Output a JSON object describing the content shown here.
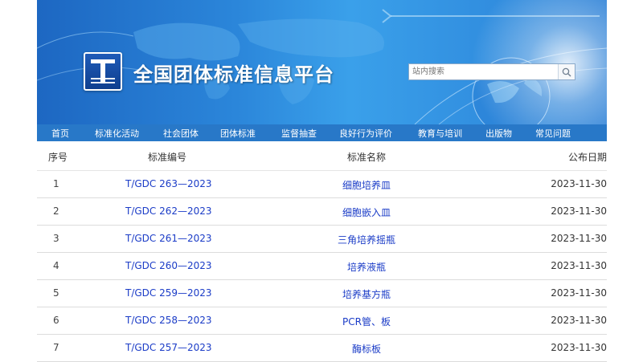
{
  "site": {
    "title": "全国团体标准信息平台",
    "search_placeholder": "站内搜索"
  },
  "nav": [
    "首页",
    "标准化活动",
    "社会团体",
    "团体标准",
    "监督抽查",
    "良好行为评价",
    "教育与培训",
    "出版物",
    "常见问题"
  ],
  "table": {
    "headers": [
      "序号",
      "标准编号",
      "标准名称",
      "公布日期"
    ],
    "rows": [
      {
        "idx": "1",
        "code": "T/GDC 263—2023",
        "name": "细胞培养皿",
        "date": "2023-11-30"
      },
      {
        "idx": "2",
        "code": "T/GDC 262—2023",
        "name": "细胞嵌入皿",
        "date": "2023-11-30"
      },
      {
        "idx": "3",
        "code": "T/GDC 261—2023",
        "name": "三角培养摇瓶",
        "date": "2023-11-30"
      },
      {
        "idx": "4",
        "code": "T/GDC 260—2023",
        "name": "培养液瓶",
        "date": "2023-11-30"
      },
      {
        "idx": "5",
        "code": "T/GDC 259—2023",
        "name": "培养基方瓶",
        "date": "2023-11-30"
      },
      {
        "idx": "6",
        "code": "T/GDC 258—2023",
        "name": "PCR管、板",
        "date": "2023-11-30"
      },
      {
        "idx": "7",
        "code": "T/GDC 257—2023",
        "name": "酶标板",
        "date": "2023-11-30"
      }
    ]
  }
}
